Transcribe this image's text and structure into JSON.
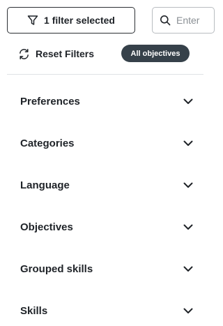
{
  "toolbar": {
    "filter_button_label": "1 filter selected",
    "search_placeholder": "Enter",
    "reset_label": "Reset Filters",
    "objectives_pill_label": "All objectives"
  },
  "accordion": [
    {
      "label": "Preferences"
    },
    {
      "label": "Categories"
    },
    {
      "label": "Language"
    },
    {
      "label": "Objectives"
    },
    {
      "label": "Grouped skills"
    },
    {
      "label": "Skills"
    }
  ]
}
